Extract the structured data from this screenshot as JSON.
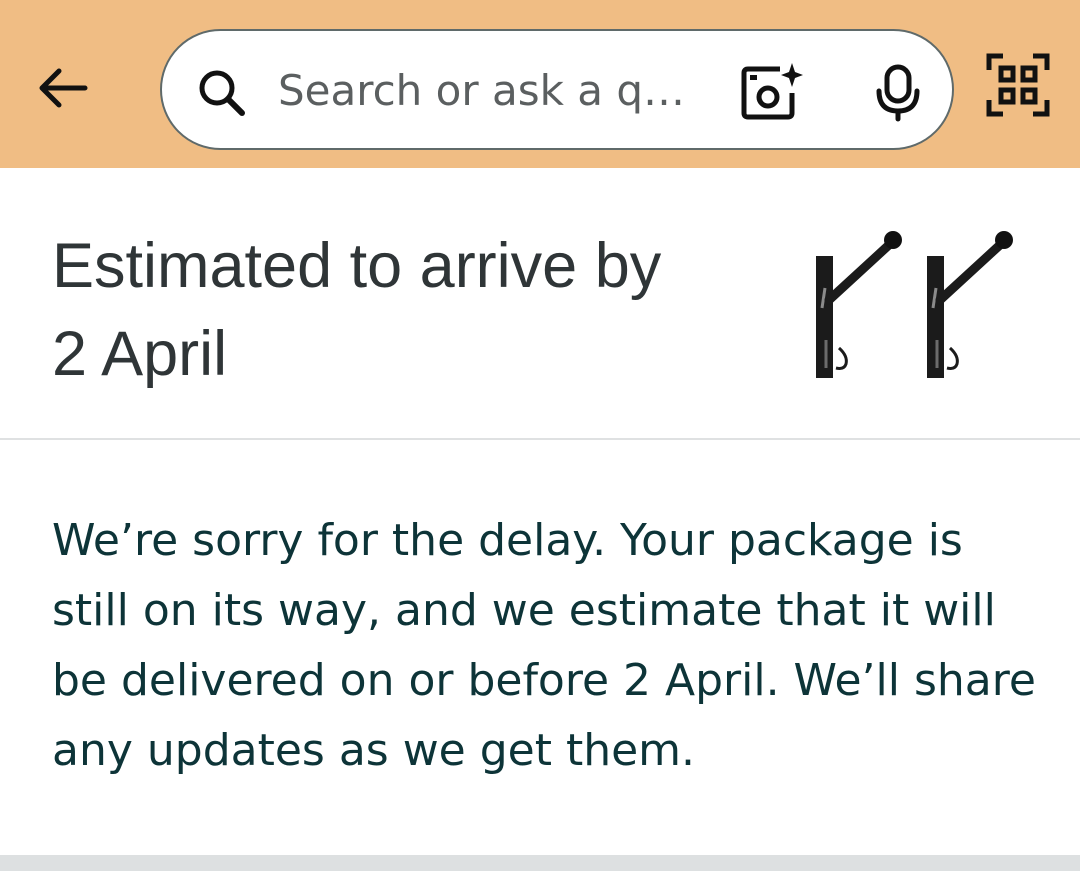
{
  "header": {
    "back_icon": "arrow-left-icon",
    "search": {
      "placeholder": "Search or ask a qu…",
      "icon": "search-icon"
    },
    "camera_icon": "camera-sparkle-icon",
    "mic_icon": "microphone-icon",
    "scan_icon": "qr-scan-icon",
    "background_color": "#f0bd84"
  },
  "delivery": {
    "title_line1": "Estimated to arrive by",
    "title_line2": "2 April",
    "product_image": "wall-hooks-product-image"
  },
  "message": {
    "text": "We’re sorry for the delay. Your package is still on its way, and we estimate that it will be delivered on or before 2 April. We’ll share any updates as we get them."
  },
  "colors": {
    "title_text": "#2f3537",
    "message_text": "#0d3438",
    "divider": "#dfe1e2"
  }
}
